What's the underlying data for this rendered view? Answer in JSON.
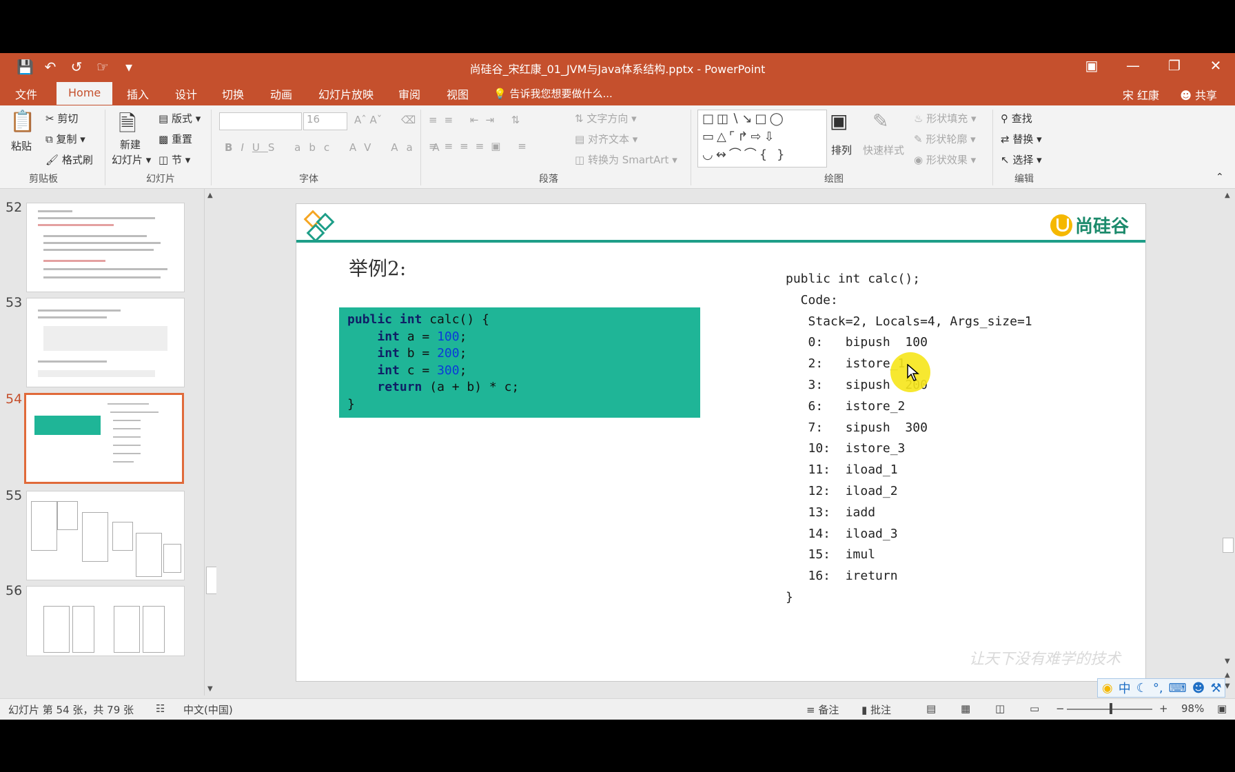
{
  "window": {
    "title": "尚硅谷_宋红康_01_JVM与Java体系结构.pptx - PowerPoint",
    "accent_color": "#c5502d",
    "user": "宋 红康",
    "share": "共享"
  },
  "tabs": [
    "文件",
    "Home",
    "插入",
    "设计",
    "切换",
    "动画",
    "幻灯片放映",
    "审阅",
    "视图"
  ],
  "active_tab": "Home",
  "tell_me": "告诉我您想要做什么...",
  "ribbon": {
    "clipboard": {
      "paste": "粘贴",
      "cut": "剪切",
      "copy": "复制",
      "format_painter": "格式刷",
      "label": "剪贴板"
    },
    "slides": {
      "new_slide": "新建",
      "new_slide2": "幻灯片",
      "layout": "版式",
      "reset": "重置",
      "section": "节",
      "label": "幻灯片"
    },
    "font": {
      "size": "16",
      "label": "字体"
    },
    "paragraph": {
      "text_direction": "文字方向",
      "align_text": "对齐文本",
      "convert_smartart": "转换为 SmartArt",
      "label": "段落"
    },
    "drawing": {
      "arrange": "排列",
      "quick_styles": "快速样式",
      "shape_fill": "形状填充",
      "shape_outline": "形状轮廓",
      "shape_effects": "形状效果",
      "label": "绘图"
    },
    "editing": {
      "find": "查找",
      "replace": "替换",
      "select": "选择",
      "label": "编辑"
    }
  },
  "thumbnails": [
    {
      "num": "52",
      "current": false
    },
    {
      "num": "53",
      "current": false
    },
    {
      "num": "54",
      "current": true
    },
    {
      "num": "55",
      "current": false
    },
    {
      "num": "56",
      "current": false
    }
  ],
  "slide": {
    "heading": "举例2:",
    "brand": "尚硅谷",
    "watermark": "让天下没有难学的技术",
    "code": [
      "public int calc() {",
      "    int a = 100;",
      "    int b = 200;",
      "    int c = 300;",
      "    return (a + b) * c;",
      "}"
    ],
    "bytecode": [
      "public int calc();",
      "  Code:",
      "   Stack=2, Locals=4, Args_size=1",
      "   0:   bipush  100",
      "   2:   istore_1",
      "   3:   sipush  200",
      "   6:   istore_2",
      "   7:   sipush  300",
      "   10:  istore_3",
      "   11:  iload_1",
      "   12:  iload_2",
      "   13:  iadd",
      "   14:  iload_3",
      "   15:  imul",
      "   16:  ireturn",
      "}"
    ]
  },
  "status": {
    "slide_info": "幻灯片 第 54 张，共 79 张",
    "language": "中文(中国)",
    "notes": "备注",
    "comments": "批注",
    "zoom": "98%"
  },
  "ime": "中"
}
